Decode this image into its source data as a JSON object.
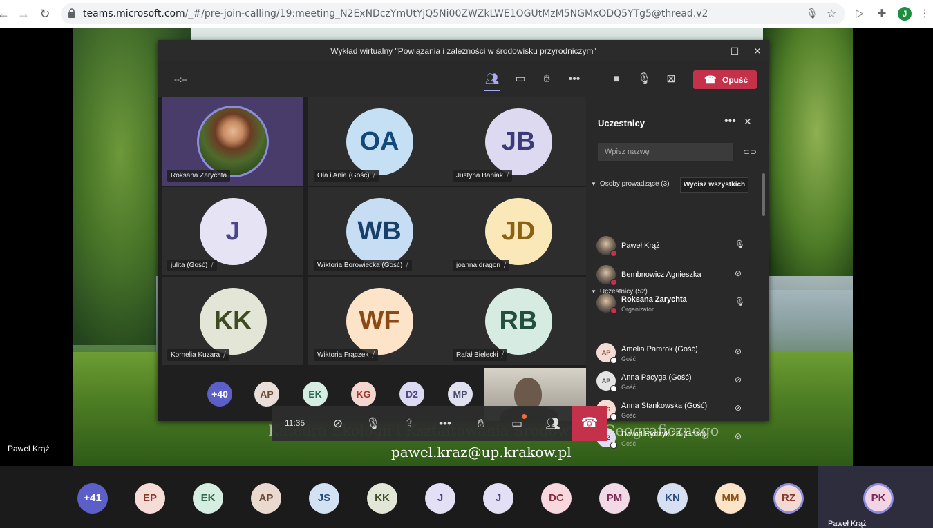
{
  "browser": {
    "url_host": "teams.microsoft.com",
    "url_rest": "/_#/pre-join-calling/19:meeting_N2ExNDczYmUtYjQ5Ni00ZWZkLWE1OGUtMzM5NGMxODQ5YTg5@thread.v2",
    "profile_initial": "J"
  },
  "presenter_label": "Paweł Krąż",
  "slide": {
    "caption_line1": "Katedra Ekologii i Kształtowania Środowiska Geograficznego",
    "caption_line2": "pawel.kraz@up.krakow.pl"
  },
  "teams_window": {
    "title": "Wykład wirtualny \"Powiązania i zależności w środowisku przyrodniczym\"",
    "timer": "--:--",
    "leave_label": "Opuść"
  },
  "video_grid": [
    {
      "initials": "",
      "name": "Roksana Zarychta",
      "photo": true,
      "bg": "#4a3c6a",
      "fg": "#fff"
    },
    {
      "initials": "OA",
      "name": "Ola i Ania (Gość)",
      "photo": false,
      "bg": "#c5dff5",
      "fg": "#13497a"
    },
    {
      "initials": "JB",
      "name": "Justyna Baniak",
      "photo": false,
      "bg": "#dcd9f0",
      "fg": "#3d3a7a"
    },
    {
      "initials": "J",
      "name": "julita (Gość)",
      "photo": false,
      "bg": "#e6e3f5",
      "fg": "#4b4786"
    },
    {
      "initials": "WB",
      "name": "Wiktoria Borowiecka (Gość)",
      "photo": false,
      "bg": "#c7ddf3",
      "fg": "#17416b"
    },
    {
      "initials": "JD",
      "name": "joanna dragon",
      "photo": false,
      "bg": "#fbe8b8",
      "fg": "#8a6212"
    },
    {
      "initials": "KK",
      "name": "Kornelia Kuzara",
      "photo": false,
      "bg": "#e3e6d6",
      "fg": "#3e4a22"
    },
    {
      "initials": "WF",
      "name": "Wiktoria Frączek",
      "photo": false,
      "bg": "#fde3c7",
      "fg": "#8a4a14"
    },
    {
      "initials": "RB",
      "name": "Rafał Bielecki",
      "photo": false,
      "bg": "#d6ece3",
      "fg": "#22503c"
    }
  ],
  "overflow_strip": [
    {
      "initials": "+40",
      "bg": "#5b5fc7",
      "fg": "#fff"
    },
    {
      "initials": "AP",
      "bg": "#e9dfd8",
      "fg": "#6a4a3a"
    },
    {
      "initials": "EK",
      "bg": "#d6ede2",
      "fg": "#2f6a4f"
    },
    {
      "initials": "KG",
      "bg": "#f5d5d0",
      "fg": "#9a3a2a"
    },
    {
      "initials": "D2",
      "bg": "#dcdaf2",
      "fg": "#4b4786"
    },
    {
      "initials": "MP",
      "bg": "#e0e1ef",
      "fg": "#474a6a"
    }
  ],
  "participants_panel": {
    "title": "Uczestnicy",
    "search_placeholder": "Wpisz nazwę",
    "presenters_header": "Osoby prowadzące (3)",
    "mute_all_label": "Wycisz wszystkich",
    "attendees_header": "Uczestnicy (52)",
    "presenters": [
      {
        "name": "Paweł Krąż",
        "sub": "",
        "initials": "",
        "photo": true,
        "mic": "on",
        "bold": false,
        "dot": "#c4314b"
      },
      {
        "name": "Bembnowicz Agnieszka",
        "sub": "",
        "initials": "",
        "photo": true,
        "mic": "muted",
        "bold": false,
        "dot": "#c4314b"
      },
      {
        "name": "Roksana Zarychta",
        "sub": "Organizator",
        "initials": "",
        "photo": true,
        "mic": "on",
        "bold": true,
        "dot": "#c4314b"
      }
    ],
    "attendees": [
      {
        "name": "Amelia Pamrok (Gość)",
        "sub": "Gość",
        "initials": "AP",
        "bg": "#f3dcd6",
        "fg": "#8a3a2a",
        "mic": "muted"
      },
      {
        "name": "Anna Pacyga (Gość)",
        "sub": "Gość",
        "initials": "AP",
        "bg": "#e4e4e4",
        "fg": "#555",
        "mic": "muted"
      },
      {
        "name": "Anna Stankowska (Gość)",
        "sub": "Gość",
        "initials": "AS",
        "bg": "#f6dcd3",
        "fg": "#9a3a2a",
        "mic": "muted"
      },
      {
        "name": "Dawid Rydzyk 2B (Gość)",
        "sub": "Gość",
        "initials": "D2",
        "bg": "#e0dff2",
        "fg": "#4b4786",
        "mic": "muted"
      }
    ]
  },
  "call_controls": {
    "time": "11:35"
  },
  "bottom_gallery": [
    {
      "initials": "+41",
      "bg": "#5b5fc7",
      "fg": "#fff"
    },
    {
      "initials": "EP",
      "bg": "#f6dcd6",
      "fg": "#8a3a2a"
    },
    {
      "initials": "EK",
      "bg": "#d6ede2",
      "fg": "#2f6a4f"
    },
    {
      "initials": "AP",
      "bg": "#ead9cf",
      "fg": "#6a4a3a"
    },
    {
      "initials": "JS",
      "bg": "#d3e2f2",
      "fg": "#2a4e7a"
    },
    {
      "initials": "KK",
      "bg": "#e1e6d6",
      "fg": "#3e4a22"
    },
    {
      "initials": "J",
      "bg": "#e3e0f5",
      "fg": "#4b4786"
    },
    {
      "initials": "J",
      "bg": "#e3e0f5",
      "fg": "#4b4786"
    },
    {
      "initials": "DC",
      "bg": "#f6d8de",
      "fg": "#8a2a3a"
    },
    {
      "initials": "PM",
      "bg": "#f1d9e6",
      "fg": "#7a2a55"
    },
    {
      "initials": "KN",
      "bg": "#d6e0f2",
      "fg": "#2a4e7a"
    },
    {
      "initials": "MM",
      "bg": "#fbe4c8",
      "fg": "#8a5214"
    },
    {
      "initials": "RZ",
      "bg": "#f3d9d3",
      "fg": "#8a3a2a"
    }
  ],
  "self_tile": {
    "initials": "PK",
    "bg": "#f1d5e4",
    "fg": "#7a2a55",
    "label": "Paweł Krąż"
  }
}
